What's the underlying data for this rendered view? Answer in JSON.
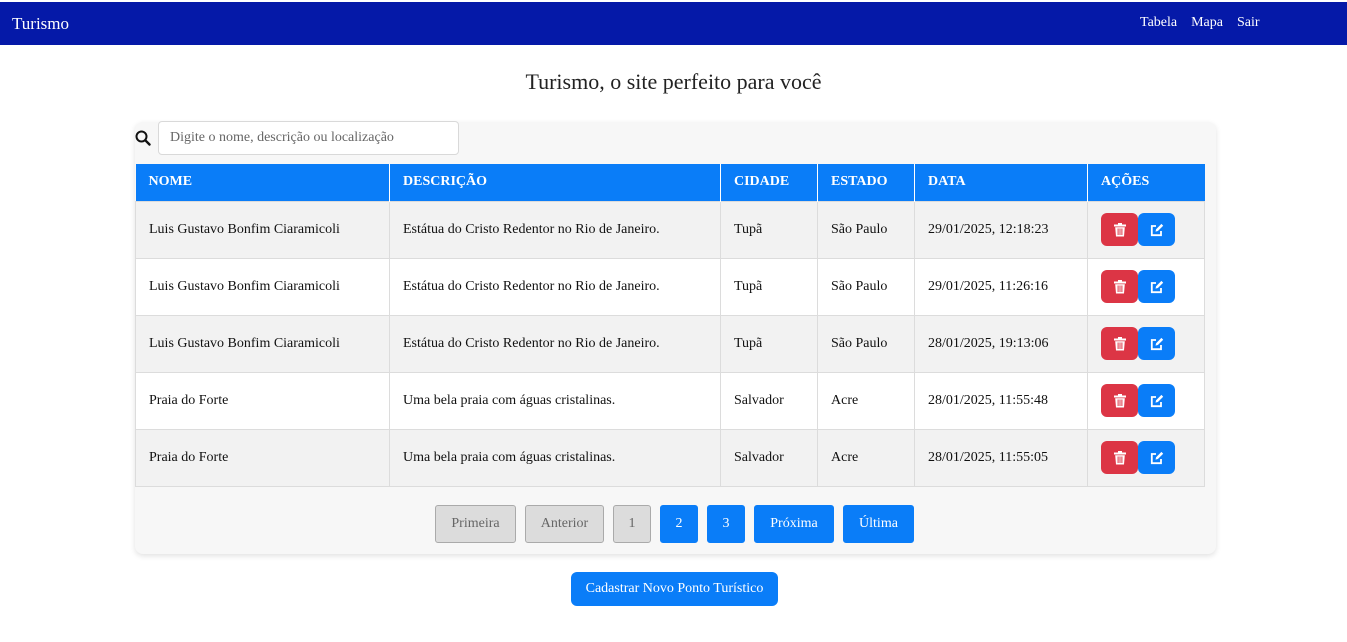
{
  "nav": {
    "brand": "Turismo",
    "links": [
      "Tabela",
      "Mapa",
      "Sair"
    ]
  },
  "page": {
    "title": "Turismo, o site perfeito para você"
  },
  "search": {
    "placeholder": "Digite o nome, descrição ou localização",
    "value": ""
  },
  "table": {
    "headers": [
      "NOME",
      "DESCRIÇÃO",
      "CIDADE",
      "ESTADO",
      "DATA",
      "AÇÕES"
    ],
    "rows": [
      {
        "nome": "Luis Gustavo Bonfim Ciaramicoli",
        "descricao": "Estátua do Cristo Redentor no Rio de Janeiro.",
        "cidade": "Tupã",
        "estado": "São Paulo",
        "data": "29/01/2025, 12:18:23"
      },
      {
        "nome": "Luis Gustavo Bonfim Ciaramicoli",
        "descricao": "Estátua do Cristo Redentor no Rio de Janeiro.",
        "cidade": "Tupã",
        "estado": "São Paulo",
        "data": "29/01/2025, 11:26:16"
      },
      {
        "nome": "Luis Gustavo Bonfim Ciaramicoli",
        "descricao": "Estátua do Cristo Redentor no Rio de Janeiro.",
        "cidade": "Tupã",
        "estado": "São Paulo",
        "data": "28/01/2025, 19:13:06"
      },
      {
        "nome": "Praia do Forte",
        "descricao": "Uma bela praia com águas cristalinas.",
        "cidade": "Salvador",
        "estado": "Acre",
        "data": "28/01/2025, 11:55:48"
      },
      {
        "nome": "Praia do Forte",
        "descricao": "Uma bela praia com águas cristalinas.",
        "cidade": "Salvador",
        "estado": "Acre",
        "data": "28/01/2025, 11:55:05"
      }
    ],
    "row_icons": {
      "delete": "trash-icon",
      "edit": "edit-icon"
    }
  },
  "pagination": {
    "first": "Primeira",
    "prev": "Anterior",
    "pages": [
      "1",
      "2",
      "3"
    ],
    "current_page": "1",
    "next": "Próxima",
    "last": "Última"
  },
  "cta": {
    "label": "Cadastrar Novo Ponto Turístico"
  },
  "colors": {
    "navbar": "#0519a8",
    "primary": "#0a7df8",
    "danger": "#dc3545"
  }
}
